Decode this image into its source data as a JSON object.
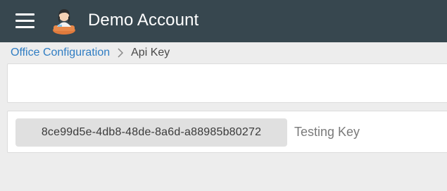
{
  "header": {
    "title": "Demo Account",
    "menu_icon": "hamburger-menu-icon",
    "avatar_icon": "user-avatar-icon",
    "background": "#37474f"
  },
  "breadcrumb": {
    "parent": "Office Configuration",
    "current": "Api Key",
    "separator_icon": "chevron-right-icon",
    "link_color": "#2f7dc3"
  },
  "api_key": {
    "value": "8ce99d5e-4db8-48de-8a6d-a88985b80272",
    "label": "Testing Key"
  }
}
